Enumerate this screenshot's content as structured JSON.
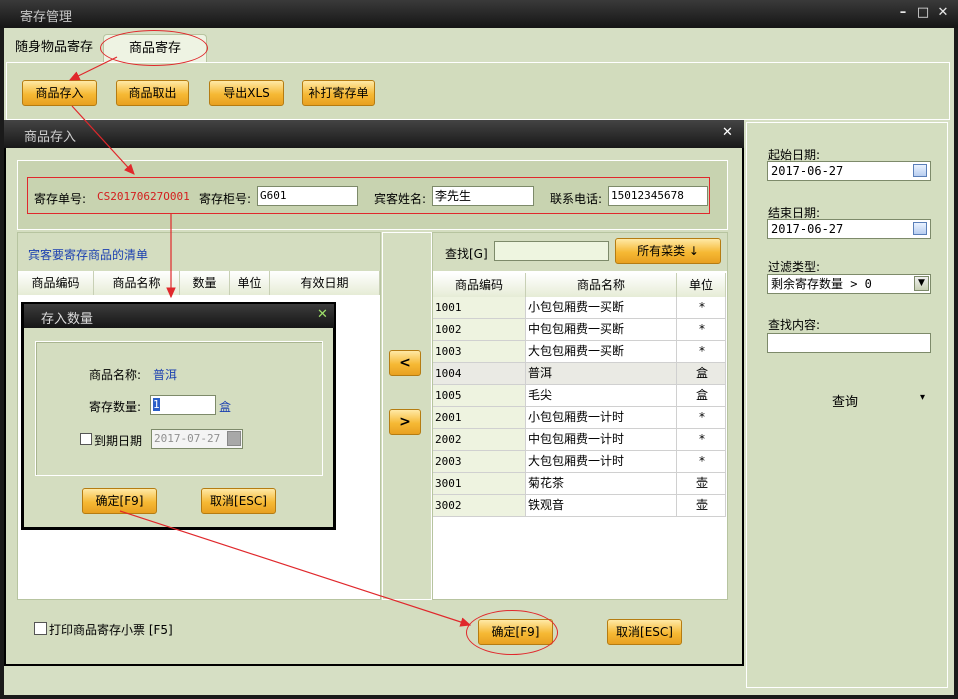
{
  "window": {
    "title": "寄存管理",
    "min": "–",
    "max": "□",
    "close": "✕"
  },
  "tabs": [
    "随身物品寄存",
    "商品寄存"
  ],
  "toolbar": {
    "deposit": "商品存入",
    "withdraw": "商品取出",
    "export": "导出XLS",
    "reprint": "补打寄存单"
  },
  "filter": {
    "start_label": "起始日期:",
    "start_value": "2017-06-27",
    "end_label": "结束日期:",
    "end_value": "2017-06-27",
    "type_label": "过滤类型:",
    "type_value": "剩余寄存数量 > 0",
    "search_label": "查找内容:",
    "search_value": "",
    "query_label": "查询",
    "query_arrow": "▾"
  },
  "deposit_dialog": {
    "title": "商品存入",
    "close": "✕",
    "order_label": "寄存单号:",
    "order_value": "CS20170627O001",
    "cabinet_label": "寄存柜号:",
    "cabinet_value": "G601",
    "guest_label": "宾客姓名:",
    "guest_value": "李先生",
    "phone_label": "联系电话:",
    "phone_value": "15012345678",
    "list_title": "宾客要寄存商品的清单",
    "left_columns": [
      "商品编码",
      "商品名称",
      "数量",
      "单位",
      "有效日期"
    ],
    "search_label": "查找[G]",
    "search_value": "",
    "all_menu": "所有菜类 ↓",
    "move_left": "<",
    "move_right": ">",
    "right_columns": [
      "商品编码",
      "商品名称",
      "单位"
    ],
    "products": [
      {
        "code": "1001",
        "name": "小包包厢费一买断",
        "unit": "*"
      },
      {
        "code": "1002",
        "name": "中包包厢费一买断",
        "unit": "*"
      },
      {
        "code": "1003",
        "name": "大包包厢费一买断",
        "unit": "*"
      },
      {
        "code": "1004",
        "name": "普洱",
        "unit": "盒"
      },
      {
        "code": "1005",
        "name": "毛尖",
        "unit": "盒"
      },
      {
        "code": "2001",
        "name": "小包包厢费一计时",
        "unit": "*"
      },
      {
        "code": "2002",
        "name": "中包包厢费一计时",
        "unit": "*"
      },
      {
        "code": "2003",
        "name": "大包包厢费一计时",
        "unit": "*"
      },
      {
        "code": "3001",
        "name": "菊花茶",
        "unit": "壶"
      },
      {
        "code": "3002",
        "name": "铁观音",
        "unit": "壶"
      }
    ],
    "print_label": "打印商品寄存小票 [F5]",
    "ok": "确定[F9]",
    "cancel": "取消[ESC]"
  },
  "qty_dialog": {
    "title": "存入数量",
    "close": "✕",
    "name_label": "商品名称:",
    "name_value": "普洱",
    "qty_label": "寄存数量:",
    "qty_value": "1",
    "qty_unit": "盒",
    "expire_label": "到期日期",
    "expire_value": "2017-07-27",
    "ok": "确定[F9]",
    "cancel": "取消[ESC]"
  }
}
